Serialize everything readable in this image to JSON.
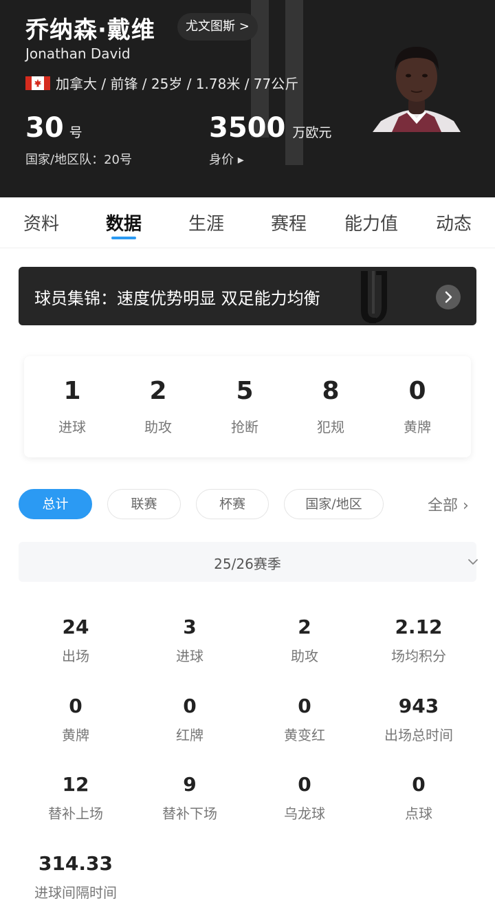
{
  "header": {
    "name_cn": "乔纳森·戴维",
    "club_link": "尤文图斯 >",
    "name_en": "Jonathan David",
    "info": "加拿大 / 前锋 / 25岁 / 1.78米 / 77公斤",
    "shirt_number": "30",
    "shirt_unit": "号",
    "national_team": "国家/地区队：20号",
    "market_value": "3500",
    "market_value_unit": "万欧元",
    "market_value_link": "身价 ▸"
  },
  "tabs": [
    {
      "label": "资料"
    },
    {
      "label": "数据"
    },
    {
      "label": "生涯"
    },
    {
      "label": "赛程"
    },
    {
      "label": "能力值"
    },
    {
      "label": "动态"
    }
  ],
  "active_tab": "数据",
  "banner": {
    "title": "球员集锦：速度优势明显 双足能力均衡"
  },
  "summary": [
    {
      "value": "1",
      "label": "进球"
    },
    {
      "value": "2",
      "label": "助攻"
    },
    {
      "value": "5",
      "label": "抢断"
    },
    {
      "value": "8",
      "label": "犯规"
    },
    {
      "value": "0",
      "label": "黄牌"
    }
  ],
  "filters": [
    {
      "label": "总计",
      "active": true
    },
    {
      "label": "联赛",
      "active": false
    },
    {
      "label": "杯赛",
      "active": false
    },
    {
      "label": "国家/地区",
      "active": false
    }
  ],
  "all_link": "全部 ›",
  "season": "25/26赛季",
  "stats": [
    {
      "value": "24",
      "label": "出场"
    },
    {
      "value": "3",
      "label": "进球"
    },
    {
      "value": "2",
      "label": "助攻"
    },
    {
      "value": "2.12",
      "label": "场均积分"
    },
    {
      "value": "0",
      "label": "黄牌"
    },
    {
      "value": "0",
      "label": "红牌"
    },
    {
      "value": "0",
      "label": "黄变红"
    },
    {
      "value": "943",
      "label": "出场总时间"
    },
    {
      "value": "12",
      "label": "替补上场"
    },
    {
      "value": "9",
      "label": "替补下场"
    },
    {
      "value": "0",
      "label": "乌龙球"
    },
    {
      "value": "0",
      "label": "点球"
    },
    {
      "value": "314.33",
      "label": "进球间隔时间"
    }
  ],
  "colors": {
    "header_bg": "#1e1e1e",
    "accent": "#2b9af3",
    "banner_bg": "#262626"
  }
}
